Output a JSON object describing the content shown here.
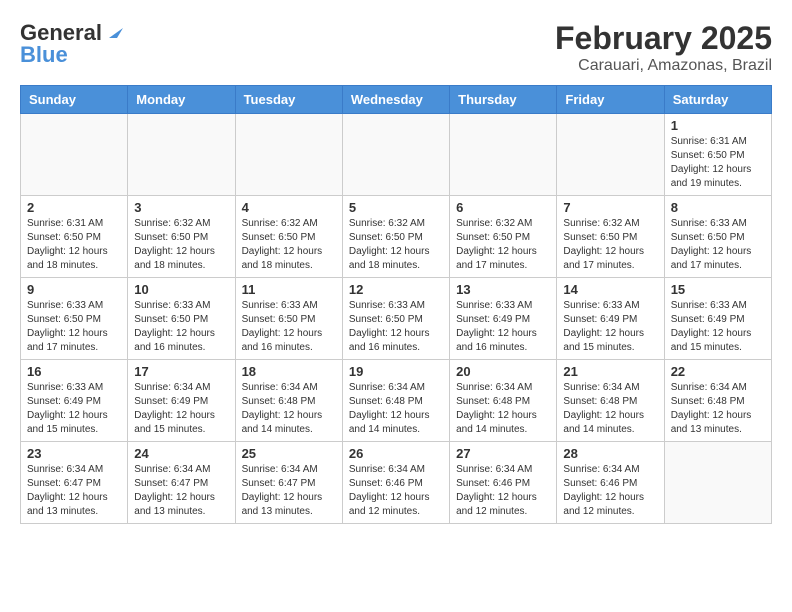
{
  "header": {
    "logo_line1": "General",
    "logo_line2": "Blue",
    "title": "February 2025",
    "subtitle": "Carauari, Amazonas, Brazil"
  },
  "weekdays": [
    "Sunday",
    "Monday",
    "Tuesday",
    "Wednesday",
    "Thursday",
    "Friday",
    "Saturday"
  ],
  "weeks": [
    [
      {
        "day": "",
        "info": ""
      },
      {
        "day": "",
        "info": ""
      },
      {
        "day": "",
        "info": ""
      },
      {
        "day": "",
        "info": ""
      },
      {
        "day": "",
        "info": ""
      },
      {
        "day": "",
        "info": ""
      },
      {
        "day": "1",
        "info": "Sunrise: 6:31 AM\nSunset: 6:50 PM\nDaylight: 12 hours\nand 19 minutes."
      }
    ],
    [
      {
        "day": "2",
        "info": "Sunrise: 6:31 AM\nSunset: 6:50 PM\nDaylight: 12 hours\nand 18 minutes."
      },
      {
        "day": "3",
        "info": "Sunrise: 6:32 AM\nSunset: 6:50 PM\nDaylight: 12 hours\nand 18 minutes."
      },
      {
        "day": "4",
        "info": "Sunrise: 6:32 AM\nSunset: 6:50 PM\nDaylight: 12 hours\nand 18 minutes."
      },
      {
        "day": "5",
        "info": "Sunrise: 6:32 AM\nSunset: 6:50 PM\nDaylight: 12 hours\nand 18 minutes."
      },
      {
        "day": "6",
        "info": "Sunrise: 6:32 AM\nSunset: 6:50 PM\nDaylight: 12 hours\nand 17 minutes."
      },
      {
        "day": "7",
        "info": "Sunrise: 6:32 AM\nSunset: 6:50 PM\nDaylight: 12 hours\nand 17 minutes."
      },
      {
        "day": "8",
        "info": "Sunrise: 6:33 AM\nSunset: 6:50 PM\nDaylight: 12 hours\nand 17 minutes."
      }
    ],
    [
      {
        "day": "9",
        "info": "Sunrise: 6:33 AM\nSunset: 6:50 PM\nDaylight: 12 hours\nand 17 minutes."
      },
      {
        "day": "10",
        "info": "Sunrise: 6:33 AM\nSunset: 6:50 PM\nDaylight: 12 hours\nand 16 minutes."
      },
      {
        "day": "11",
        "info": "Sunrise: 6:33 AM\nSunset: 6:50 PM\nDaylight: 12 hours\nand 16 minutes."
      },
      {
        "day": "12",
        "info": "Sunrise: 6:33 AM\nSunset: 6:50 PM\nDaylight: 12 hours\nand 16 minutes."
      },
      {
        "day": "13",
        "info": "Sunrise: 6:33 AM\nSunset: 6:49 PM\nDaylight: 12 hours\nand 16 minutes."
      },
      {
        "day": "14",
        "info": "Sunrise: 6:33 AM\nSunset: 6:49 PM\nDaylight: 12 hours\nand 15 minutes."
      },
      {
        "day": "15",
        "info": "Sunrise: 6:33 AM\nSunset: 6:49 PM\nDaylight: 12 hours\nand 15 minutes."
      }
    ],
    [
      {
        "day": "16",
        "info": "Sunrise: 6:33 AM\nSunset: 6:49 PM\nDaylight: 12 hours\nand 15 minutes."
      },
      {
        "day": "17",
        "info": "Sunrise: 6:34 AM\nSunset: 6:49 PM\nDaylight: 12 hours\nand 15 minutes."
      },
      {
        "day": "18",
        "info": "Sunrise: 6:34 AM\nSunset: 6:48 PM\nDaylight: 12 hours\nand 14 minutes."
      },
      {
        "day": "19",
        "info": "Sunrise: 6:34 AM\nSunset: 6:48 PM\nDaylight: 12 hours\nand 14 minutes."
      },
      {
        "day": "20",
        "info": "Sunrise: 6:34 AM\nSunset: 6:48 PM\nDaylight: 12 hours\nand 14 minutes."
      },
      {
        "day": "21",
        "info": "Sunrise: 6:34 AM\nSunset: 6:48 PM\nDaylight: 12 hours\nand 14 minutes."
      },
      {
        "day": "22",
        "info": "Sunrise: 6:34 AM\nSunset: 6:48 PM\nDaylight: 12 hours\nand 13 minutes."
      }
    ],
    [
      {
        "day": "23",
        "info": "Sunrise: 6:34 AM\nSunset: 6:47 PM\nDaylight: 12 hours\nand 13 minutes."
      },
      {
        "day": "24",
        "info": "Sunrise: 6:34 AM\nSunset: 6:47 PM\nDaylight: 12 hours\nand 13 minutes."
      },
      {
        "day": "25",
        "info": "Sunrise: 6:34 AM\nSunset: 6:47 PM\nDaylight: 12 hours\nand 13 minutes."
      },
      {
        "day": "26",
        "info": "Sunrise: 6:34 AM\nSunset: 6:46 PM\nDaylight: 12 hours\nand 12 minutes."
      },
      {
        "day": "27",
        "info": "Sunrise: 6:34 AM\nSunset: 6:46 PM\nDaylight: 12 hours\nand 12 minutes."
      },
      {
        "day": "28",
        "info": "Sunrise: 6:34 AM\nSunset: 6:46 PM\nDaylight: 12 hours\nand 12 minutes."
      },
      {
        "day": "",
        "info": ""
      }
    ]
  ]
}
